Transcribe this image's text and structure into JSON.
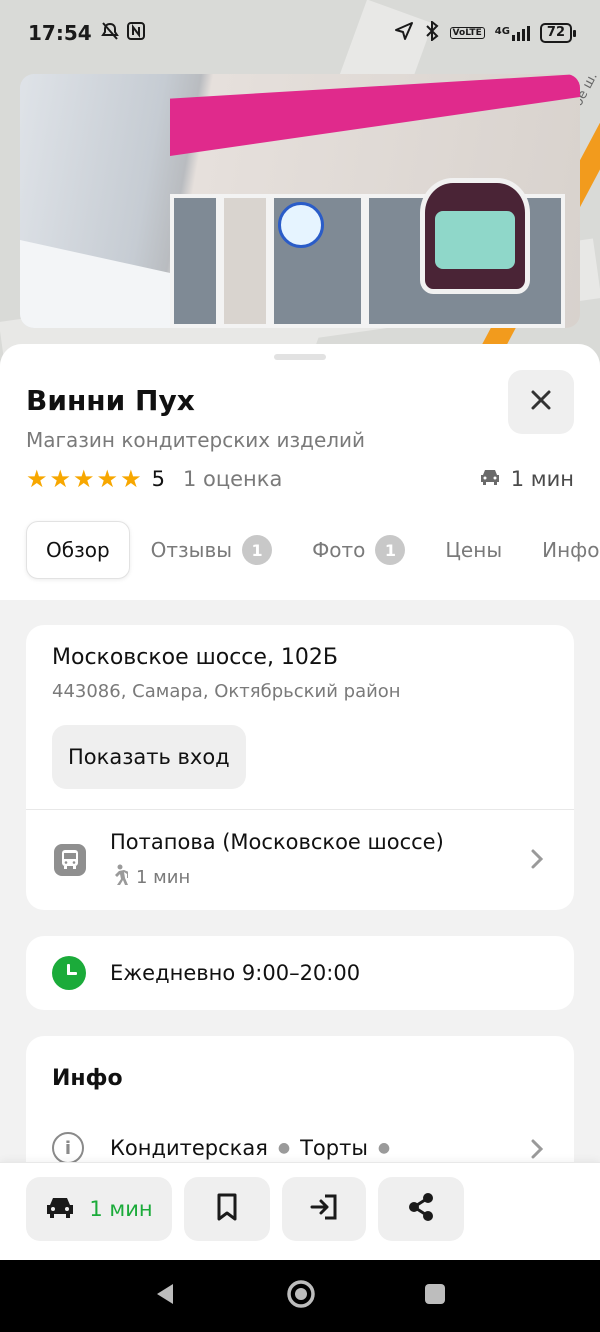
{
  "status_bar": {
    "time": "17:54",
    "battery": "72",
    "network": "4G"
  },
  "map": {
    "road_label": "ковское ш."
  },
  "place": {
    "name": "Винни Пух",
    "category": "Магазин кондитерских изделий",
    "rating_value": "5",
    "rating_count": "1 оценка",
    "stars": 5,
    "drive_time": "1 мин"
  },
  "tabs": [
    {
      "label": "Обзор",
      "active": true
    },
    {
      "label": "Отзывы",
      "count": "1"
    },
    {
      "label": "Фото",
      "count": "1"
    },
    {
      "label": "Цены"
    },
    {
      "label": "Инфо"
    }
  ],
  "address": {
    "main": "Московское шоссе, 102Б",
    "sub": "443086, Самара, Октябрьский район",
    "entrance_button": "Показать вход"
  },
  "transit": {
    "stop_name": "Потапова (Московское шоссе)",
    "walk_time": "1 мин"
  },
  "hours": {
    "text": "Ежедневно 9:00–20:00"
  },
  "info": {
    "title": "Инфо",
    "categories": [
      "Кондитерская",
      "Торты"
    ]
  },
  "action_bar": {
    "route_label": "1 мин"
  },
  "colors": {
    "accent_green": "#1bab3a",
    "star_yellow": "#f7a700",
    "map_stripe": "#f29b1d"
  }
}
